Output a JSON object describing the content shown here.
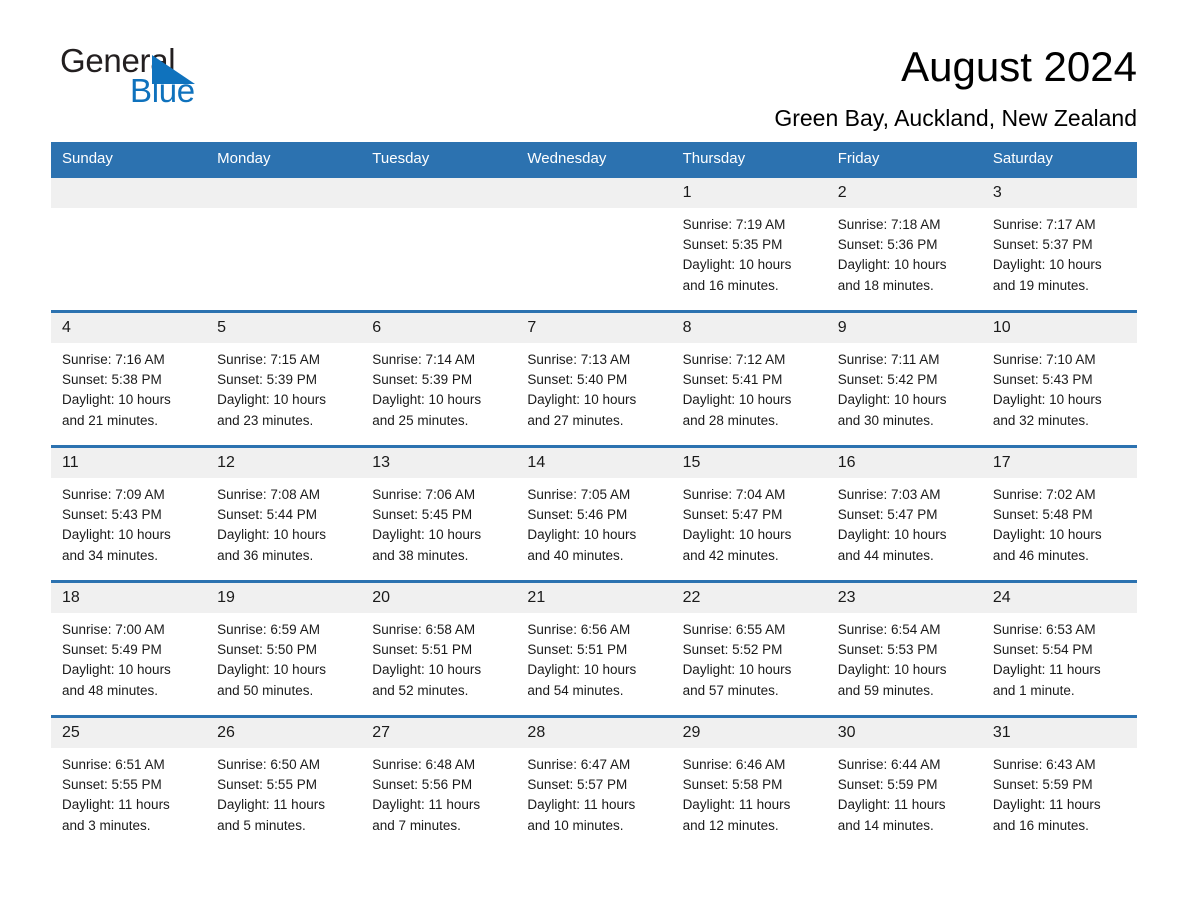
{
  "brand": {
    "word_general": "General",
    "word_blue": "Blue",
    "triangle_color": "#0f72bd"
  },
  "header": {
    "title": "August 2024",
    "location": "Green Bay, Auckland, New Zealand"
  },
  "theme": {
    "header_blue": "#2c72b0",
    "daynum_gray": "#f0f0f0",
    "text": "#1a1a1a"
  },
  "calendar": {
    "weekday_headers": [
      "Sunday",
      "Monday",
      "Tuesday",
      "Wednesday",
      "Thursday",
      "Friday",
      "Saturday"
    ],
    "labels": {
      "sunrise": "Sunrise:",
      "sunset": "Sunset:",
      "daylight": "Daylight:"
    },
    "weeks": [
      [
        {
          "day": "",
          "l1": "",
          "l2": "",
          "l3": "",
          "l4": ""
        },
        {
          "day": "",
          "l1": "",
          "l2": "",
          "l3": "",
          "l4": ""
        },
        {
          "day": "",
          "l1": "",
          "l2": "",
          "l3": "",
          "l4": ""
        },
        {
          "day": "",
          "l1": "",
          "l2": "",
          "l3": "",
          "l4": ""
        },
        {
          "day": "1",
          "l1": "Sunrise: 7:19 AM",
          "l2": "Sunset: 5:35 PM",
          "l3": "Daylight: 10 hours",
          "l4": "and 16 minutes."
        },
        {
          "day": "2",
          "l1": "Sunrise: 7:18 AM",
          "l2": "Sunset: 5:36 PM",
          "l3": "Daylight: 10 hours",
          "l4": "and 18 minutes."
        },
        {
          "day": "3",
          "l1": "Sunrise: 7:17 AM",
          "l2": "Sunset: 5:37 PM",
          "l3": "Daylight: 10 hours",
          "l4": "and 19 minutes."
        }
      ],
      [
        {
          "day": "4",
          "l1": "Sunrise: 7:16 AM",
          "l2": "Sunset: 5:38 PM",
          "l3": "Daylight: 10 hours",
          "l4": "and 21 minutes."
        },
        {
          "day": "5",
          "l1": "Sunrise: 7:15 AM",
          "l2": "Sunset: 5:39 PM",
          "l3": "Daylight: 10 hours",
          "l4": "and 23 minutes."
        },
        {
          "day": "6",
          "l1": "Sunrise: 7:14 AM",
          "l2": "Sunset: 5:39 PM",
          "l3": "Daylight: 10 hours",
          "l4": "and 25 minutes."
        },
        {
          "day": "7",
          "l1": "Sunrise: 7:13 AM",
          "l2": "Sunset: 5:40 PM",
          "l3": "Daylight: 10 hours",
          "l4": "and 27 minutes."
        },
        {
          "day": "8",
          "l1": "Sunrise: 7:12 AM",
          "l2": "Sunset: 5:41 PM",
          "l3": "Daylight: 10 hours",
          "l4": "and 28 minutes."
        },
        {
          "day": "9",
          "l1": "Sunrise: 7:11 AM",
          "l2": "Sunset: 5:42 PM",
          "l3": "Daylight: 10 hours",
          "l4": "and 30 minutes."
        },
        {
          "day": "10",
          "l1": "Sunrise: 7:10 AM",
          "l2": "Sunset: 5:43 PM",
          "l3": "Daylight: 10 hours",
          "l4": "and 32 minutes."
        }
      ],
      [
        {
          "day": "11",
          "l1": "Sunrise: 7:09 AM",
          "l2": "Sunset: 5:43 PM",
          "l3": "Daylight: 10 hours",
          "l4": "and 34 minutes."
        },
        {
          "day": "12",
          "l1": "Sunrise: 7:08 AM",
          "l2": "Sunset: 5:44 PM",
          "l3": "Daylight: 10 hours",
          "l4": "and 36 minutes."
        },
        {
          "day": "13",
          "l1": "Sunrise: 7:06 AM",
          "l2": "Sunset: 5:45 PM",
          "l3": "Daylight: 10 hours",
          "l4": "and 38 minutes."
        },
        {
          "day": "14",
          "l1": "Sunrise: 7:05 AM",
          "l2": "Sunset: 5:46 PM",
          "l3": "Daylight: 10 hours",
          "l4": "and 40 minutes."
        },
        {
          "day": "15",
          "l1": "Sunrise: 7:04 AM",
          "l2": "Sunset: 5:47 PM",
          "l3": "Daylight: 10 hours",
          "l4": "and 42 minutes."
        },
        {
          "day": "16",
          "l1": "Sunrise: 7:03 AM",
          "l2": "Sunset: 5:47 PM",
          "l3": "Daylight: 10 hours",
          "l4": "and 44 minutes."
        },
        {
          "day": "17",
          "l1": "Sunrise: 7:02 AM",
          "l2": "Sunset: 5:48 PM",
          "l3": "Daylight: 10 hours",
          "l4": "and 46 minutes."
        }
      ],
      [
        {
          "day": "18",
          "l1": "Sunrise: 7:00 AM",
          "l2": "Sunset: 5:49 PM",
          "l3": "Daylight: 10 hours",
          "l4": "and 48 minutes."
        },
        {
          "day": "19",
          "l1": "Sunrise: 6:59 AM",
          "l2": "Sunset: 5:50 PM",
          "l3": "Daylight: 10 hours",
          "l4": "and 50 minutes."
        },
        {
          "day": "20",
          "l1": "Sunrise: 6:58 AM",
          "l2": "Sunset: 5:51 PM",
          "l3": "Daylight: 10 hours",
          "l4": "and 52 minutes."
        },
        {
          "day": "21",
          "l1": "Sunrise: 6:56 AM",
          "l2": "Sunset: 5:51 PM",
          "l3": "Daylight: 10 hours",
          "l4": "and 54 minutes."
        },
        {
          "day": "22",
          "l1": "Sunrise: 6:55 AM",
          "l2": "Sunset: 5:52 PM",
          "l3": "Daylight: 10 hours",
          "l4": "and 57 minutes."
        },
        {
          "day": "23",
          "l1": "Sunrise: 6:54 AM",
          "l2": "Sunset: 5:53 PM",
          "l3": "Daylight: 10 hours",
          "l4": "and 59 minutes."
        },
        {
          "day": "24",
          "l1": "Sunrise: 6:53 AM",
          "l2": "Sunset: 5:54 PM",
          "l3": "Daylight: 11 hours",
          "l4": "and 1 minute."
        }
      ],
      [
        {
          "day": "25",
          "l1": "Sunrise: 6:51 AM",
          "l2": "Sunset: 5:55 PM",
          "l3": "Daylight: 11 hours",
          "l4": "and 3 minutes."
        },
        {
          "day": "26",
          "l1": "Sunrise: 6:50 AM",
          "l2": "Sunset: 5:55 PM",
          "l3": "Daylight: 11 hours",
          "l4": "and 5 minutes."
        },
        {
          "day": "27",
          "l1": "Sunrise: 6:48 AM",
          "l2": "Sunset: 5:56 PM",
          "l3": "Daylight: 11 hours",
          "l4": "and 7 minutes."
        },
        {
          "day": "28",
          "l1": "Sunrise: 6:47 AM",
          "l2": "Sunset: 5:57 PM",
          "l3": "Daylight: 11 hours",
          "l4": "and 10 minutes."
        },
        {
          "day": "29",
          "l1": "Sunrise: 6:46 AM",
          "l2": "Sunset: 5:58 PM",
          "l3": "Daylight: 11 hours",
          "l4": "and 12 minutes."
        },
        {
          "day": "30",
          "l1": "Sunrise: 6:44 AM",
          "l2": "Sunset: 5:59 PM",
          "l3": "Daylight: 11 hours",
          "l4": "and 14 minutes."
        },
        {
          "day": "31",
          "l1": "Sunrise: 6:43 AM",
          "l2": "Sunset: 5:59 PM",
          "l3": "Daylight: 11 hours",
          "l4": "and 16 minutes."
        }
      ]
    ]
  }
}
